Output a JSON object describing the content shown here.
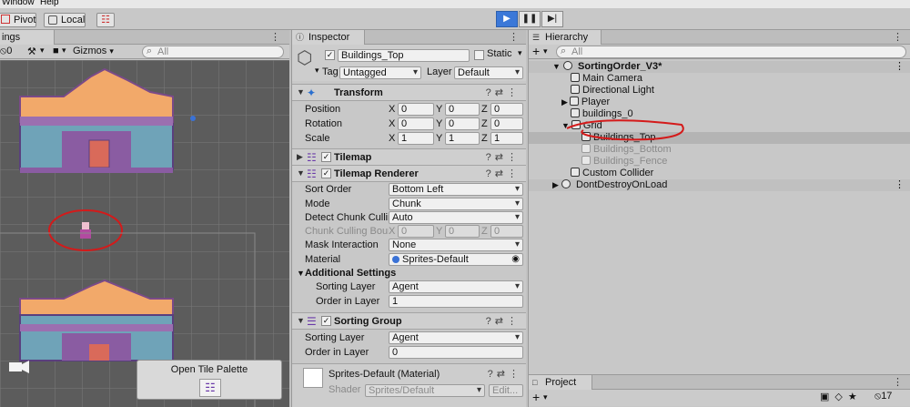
{
  "menu": {
    "window": "Window",
    "help": "Help"
  },
  "toolbar": {
    "pivot_label": "Pivot",
    "local_label": "Local",
    "play_icon": "play-icon",
    "pause_icon": "pause-icon",
    "step_icon": "step-icon"
  },
  "scene": {
    "tab_label": "ings",
    "badge": "0",
    "gizmos_label": "Gizmos",
    "search_placeholder": "All",
    "tile_palette_button": "Open Tile Palette"
  },
  "inspector": {
    "tab_label": "Inspector",
    "object_name": "Buildings_Top",
    "static_label": "Static",
    "tag_label": "Tag",
    "tag_value": "Untagged",
    "layer_label": "Layer",
    "layer_value": "Default",
    "transform": {
      "title": "Transform",
      "position_label": "Position",
      "rotation_label": "Rotation",
      "scale_label": "Scale",
      "axis_x": "X",
      "axis_y": "Y",
      "axis_z": "Z",
      "position": [
        "0",
        "0",
        "0"
      ],
      "rotation": [
        "0",
        "0",
        "0"
      ],
      "scale": [
        "1",
        "1",
        "1"
      ]
    },
    "tilemap": {
      "title": "Tilemap"
    },
    "renderer": {
      "title": "Tilemap Renderer",
      "sort_order_label": "Sort Order",
      "sort_order_value": "Bottom Left",
      "mode_label": "Mode",
      "mode_value": "Chunk",
      "detect_label": "Detect Chunk Culling",
      "detect_value": "Auto",
      "bounds_label": "Chunk Culling Bounds",
      "bounds": [
        "0",
        "0",
        "0"
      ],
      "mask_label": "Mask Interaction",
      "mask_value": "None",
      "material_label": "Material",
      "material_value": "Sprites-Default",
      "additional_label": "Additional Settings",
      "sorting_layer_label": "Sorting Layer",
      "sorting_layer_value": "Agent",
      "order_label": "Order in Layer",
      "order_value": "1"
    },
    "sorting_group": {
      "title": "Sorting Group",
      "sorting_layer_label": "Sorting Layer",
      "sorting_layer_value": "Agent",
      "order_label": "Order in Layer",
      "order_value": "0"
    },
    "material": {
      "name": "Sprites-Default (Material)",
      "shader_label": "Shader",
      "shader_value": "Sprites/Default",
      "edit_label": "Edit..."
    }
  },
  "hierarchy": {
    "tab_label": "Hierarchy",
    "search_placeholder": "All",
    "scene_name": "SortingOrder_V3*",
    "items": [
      {
        "label": "Main Camera"
      },
      {
        "label": "Directional Light"
      },
      {
        "label": "Player"
      },
      {
        "label": "buildings_0"
      },
      {
        "label": "Grid"
      },
      {
        "label": "Buildings_Top"
      },
      {
        "label": "Buildings_Bottom"
      },
      {
        "label": "Buildings_Fence"
      },
      {
        "label": "Custom Collider"
      }
    ],
    "dont_destroy": "DontDestroyOnLoad"
  },
  "project": {
    "tab_label": "Project",
    "count": "17"
  },
  "colors": {
    "selection": "#3a72d6",
    "annotation": "#d41a1a",
    "roof": "#f2a96a",
    "wall": "#6fa3b8"
  }
}
